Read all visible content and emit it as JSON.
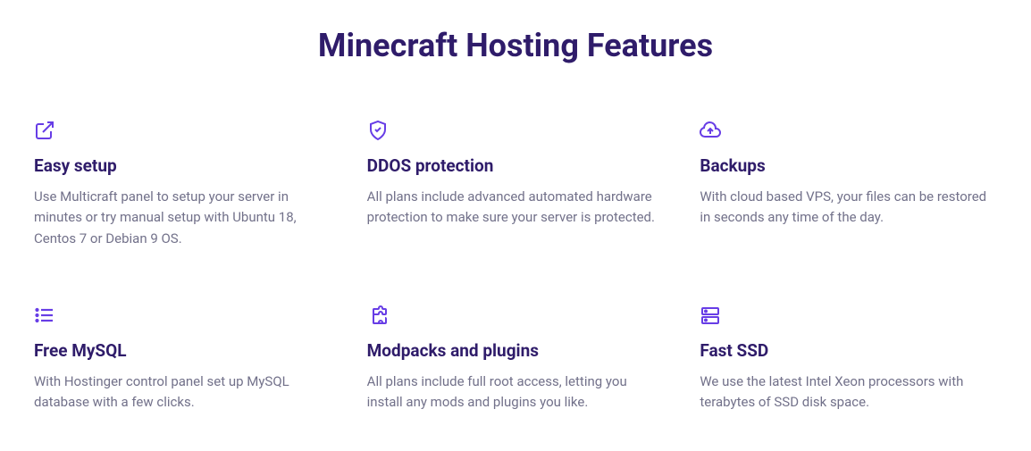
{
  "heading": "Minecraft Hosting Features",
  "features": [
    {
      "title": "Easy setup",
      "desc": "Use Multicraft panel to setup your server in minutes or try manual setup with Ubuntu 18, Centos 7 or Debian 9 OS."
    },
    {
      "title": "DDOS protection",
      "desc": "All plans include advanced automated hardware protection to make sure your server is protected."
    },
    {
      "title": "Backups",
      "desc": "With cloud based VPS, your files can be restored in seconds any time of the day."
    },
    {
      "title": "Free MySQL",
      "desc": "With Hostinger control panel set up MySQL database with a few clicks."
    },
    {
      "title": "Modpacks and plugins",
      "desc": "All plans include full root access, letting you install any mods and plugins you like."
    },
    {
      "title": "Fast SSD",
      "desc": "We use the latest Intel Xeon processors with terabytes of SSD disk space."
    }
  ]
}
